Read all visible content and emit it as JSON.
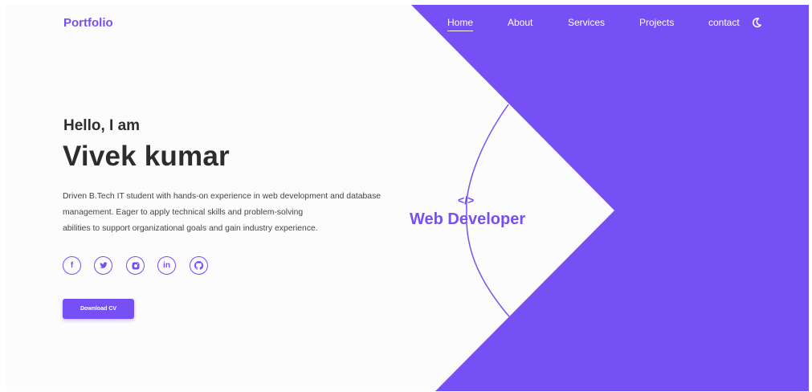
{
  "header": {
    "logo": "Portfolio",
    "nav": [
      "Home",
      "About",
      "Services",
      "Projects",
      "contact"
    ],
    "active_index": 0,
    "theme_icon": "moon-icon"
  },
  "hero": {
    "greeting": "Hello, I am",
    "name": "Vivek kumar",
    "description_lines": [
      "Driven B.Tech IT student with hands-on experience in web development and database",
      "management. Eager to apply technical skills and problem-solving",
      "abilities to support organizational goals and gain industry experience."
    ],
    "social": [
      {
        "icon": "facebook-icon",
        "glyph": "f"
      },
      {
        "icon": "twitter-icon",
        "glyph": "🐦"
      },
      {
        "icon": "instagram-icon",
        "glyph": "◘"
      },
      {
        "icon": "linkedin-icon",
        "glyph": "in"
      },
      {
        "icon": "github-icon",
        "glyph": "⊙"
      }
    ],
    "cv_button": "Download CV",
    "code_icon": "</>",
    "role": "Web Developer"
  },
  "colors": {
    "accent": "#7650f5",
    "text": "#2d2d2d",
    "background": "#fcfcfc"
  }
}
